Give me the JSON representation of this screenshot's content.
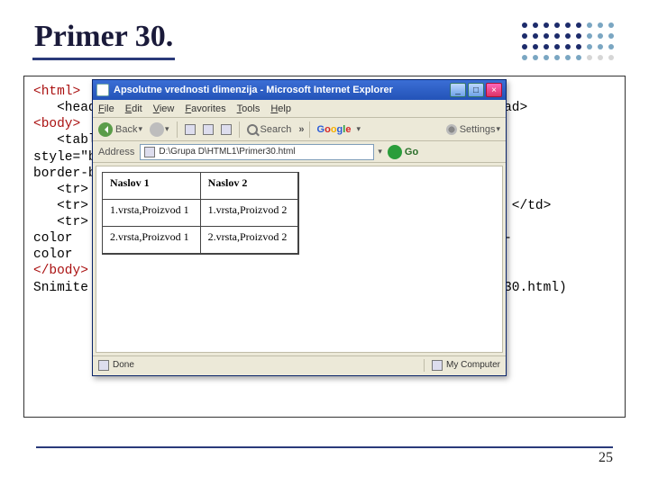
{
  "slide": {
    "title": "Primer 30.",
    "page_number": "25"
  },
  "code_lines": {
    "l0": "<html>",
    "l1": "   <head><title> Apsolutne vrednosti dimenzija </title> </head>",
    "l2": "<body>",
    "l3": "   <table border=\"1\" cellpadding=\"5\" cellspacing=\"10\"",
    "l4": "style=\"border:5px solid #6600cc; border-right-color:#6600cc;",
    "l5": "border-bottom-color: navy; background-color:#ccccff\">",
    "l6": "   <tr>",
    "l7": "",
    "l8": "   <tr>                                                    1 </td>",
    "l9": "",
    "l10": "   <tr>",
    "l11": "color                                                    tom-",
    "l12": "color",
    "l13": "",
    "l14": "</body>",
    "l15": "",
    "l16": "Snimite do                                              imer30.html)"
  },
  "ie": {
    "title": "Apsolutne vrednosti dimenzija - Microsoft Internet Explorer",
    "menu": {
      "file": "File",
      "edit": "Edit",
      "view": "View",
      "favorites": "Favorites",
      "tools": "Tools",
      "help": "Help"
    },
    "toolbar": {
      "back": "Back",
      "search": "Search",
      "settings": "Settings",
      "chevron": "»"
    },
    "address": {
      "label": "Address",
      "value": "D:\\Grupa D\\HTML1\\Primer30.html",
      "go": "Go"
    },
    "table": {
      "headers": [
        "Naslov 1",
        "Naslov 2"
      ],
      "rows": [
        [
          "1.vrsta,Proizvod 1",
          "1.vrsta,Proizvod 2"
        ],
        [
          "2.vrsta,Proizvod 1",
          "2.vrsta,Proizvod 2"
        ]
      ]
    },
    "status": {
      "done": "Done",
      "zone": "My Computer"
    },
    "google": {
      "g1": "G",
      "o1": "o",
      "o2": "o",
      "g2": "g",
      "l": "l",
      "e": "e"
    }
  }
}
